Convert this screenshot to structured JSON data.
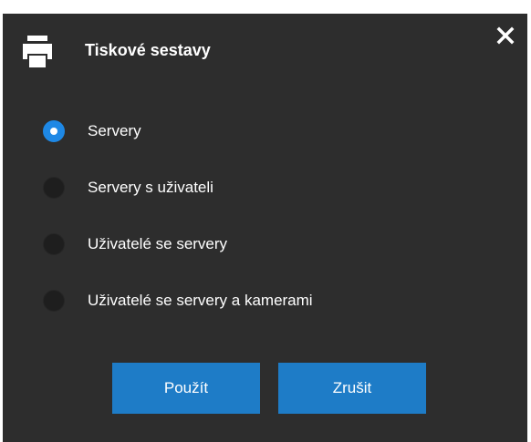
{
  "dialog": {
    "title": "Tiskové sestavy",
    "title_icon": "printer-icon",
    "close_icon": "close-icon"
  },
  "options": [
    {
      "label": "Servery",
      "checked": true
    },
    {
      "label": "Servery s uživateli",
      "checked": false
    },
    {
      "label": "Uživatelé se servery",
      "checked": false
    },
    {
      "label": "Uživatelé se servery a kamerami",
      "checked": false
    }
  ],
  "buttons": {
    "apply_label": "Použít",
    "cancel_label": "Zrušit"
  },
  "colors": {
    "dialog_bg": "#2d2d2d",
    "accent": "#1e88e5",
    "button_bg": "#1e7cc7",
    "text": "#ffffff"
  }
}
